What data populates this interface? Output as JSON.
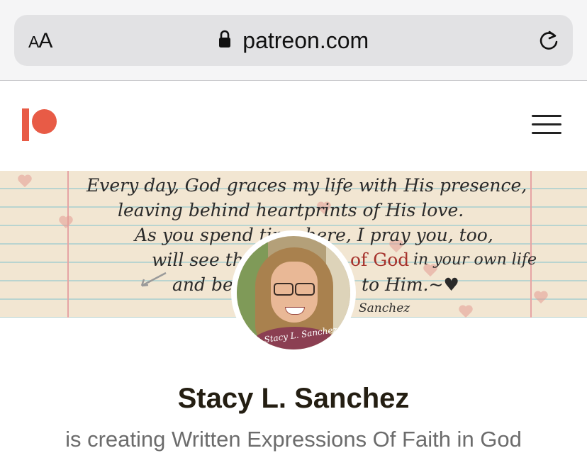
{
  "browser": {
    "text_size_label": "AA",
    "url": "patreon.com"
  },
  "banner": {
    "quote_lines": [
      "Every day, God graces my life with His presence,",
      "leaving behind heartprints of His love.",
      "As you spend time here, I pray you, too,",
      "will see the",
      "of God",
      "in your own life",
      "and be d",
      "to Him.~♥",
      "Sanchez"
    ]
  },
  "avatar": {
    "signature": "Stacy L. Sanchez"
  },
  "profile": {
    "name": "Stacy L. Sanchez",
    "description": "is creating Written Expressions Of Faith in God"
  },
  "colors": {
    "brand": "#e85b46",
    "name_text": "#241e12",
    "description_text": "#6c6c6c"
  },
  "icons": {
    "lock": "lock-icon",
    "reload": "reload-icon",
    "menu": "hamburger-menu-icon",
    "logo": "patreon-logo"
  }
}
